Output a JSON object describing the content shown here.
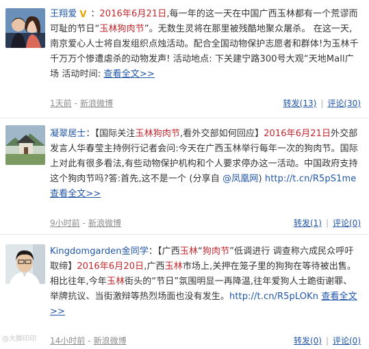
{
  "posts": [
    {
      "author": "王翔爱",
      "verified_badge": "V",
      "colon": "：",
      "segments": [
        {
          "t": "2016年6月21日",
          "c": "date"
        },
        {
          "t": ",每一年的这一天在中国广西玉林都有一个荒谬而可耻的节日“",
          "c": "n"
        },
        {
          "t": "玉林狗肉节",
          "c": "kw"
        },
        {
          "t": "”。无数生灵将在那里被残酷地聚众屠杀。 在这一天,南京爱心人士将自发组织点烛活动。配合全国动物保护志愿者和群体!为玉林千千万万个惨遭虐杀的动物发声! 活动地点: 下关建宁路300号大观“天地Mall广场 活动时间: ",
          "c": "n"
        }
      ],
      "more": "查看全文>>",
      "time": "1天前",
      "source": "新浪微博",
      "repost": "转发(13)",
      "comment": "评论(30)"
    },
    {
      "author": "凝翠居士",
      "colon": "：",
      "segments": [
        {
          "t": "【国际关注",
          "c": "n"
        },
        {
          "t": "玉林狗肉节",
          "c": "kw"
        },
        {
          "t": ",看外交部如何回应】",
          "c": "n"
        },
        {
          "t": "2016年6月21日",
          "c": "date"
        },
        {
          "t": "外交部发言人华春莹主持例行记者会问:今天在广西玉林举行每年一次的狗肉节。国际上对此有很多看法,有些动物保护机构和个人要求停办这一活动。中国政府支持这个狗肉节吗?答:首先,这不是一个 (分享自 ",
          "c": "n"
        },
        {
          "t": "@凤凰网",
          "c": "link"
        },
        {
          "t": ") ",
          "c": "n"
        },
        {
          "t": "http://t.cn/R5pS1me",
          "c": "link"
        },
        {
          "t": " ",
          "c": "n"
        }
      ],
      "more": "查看全文>>",
      "time": "9小时前",
      "source": "新浪微博",
      "repost": "转发(1)",
      "comment": "评论(0)"
    },
    {
      "author": "Kingdomgarden金同学",
      "colon": "：",
      "segments": [
        {
          "t": "【广西",
          "c": "n"
        },
        {
          "t": "玉林",
          "c": "kw"
        },
        {
          "t": "“",
          "c": "n"
        },
        {
          "t": "狗肉节",
          "c": "kw"
        },
        {
          "t": "”低调进行 调查称六成民众呼吁取缔】",
          "c": "n"
        },
        {
          "t": "2016年6月20日",
          "c": "date"
        },
        {
          "t": ",广西",
          "c": "n"
        },
        {
          "t": "玉林",
          "c": "kw"
        },
        {
          "t": "市场上,关押在笼子里的狗狗在等待被出售。相比往年,今年",
          "c": "n"
        },
        {
          "t": "玉林",
          "c": "kw"
        },
        {
          "t": "街头的“节日”氛围明显一再降温,往年爱狗人士跪街谢罪、举牌抗议、当街激辩等热烈场面也没有发生。",
          "c": "n"
        },
        {
          "t": "http://t.cn/R5pLOKn",
          "c": "link"
        },
        {
          "t": " ",
          "c": "n"
        }
      ],
      "more": "查看全文>>",
      "time": "14小时前",
      "source": "新浪微博",
      "repost": "转发(0)",
      "comment": "评论(0)"
    }
  ],
  "watermark": "@大脚印印",
  "separator": "-",
  "action_bar": "|",
  "colors": {
    "link": "#1f55a6",
    "date": "#c1272d",
    "meta": "#8c8c8c"
  }
}
